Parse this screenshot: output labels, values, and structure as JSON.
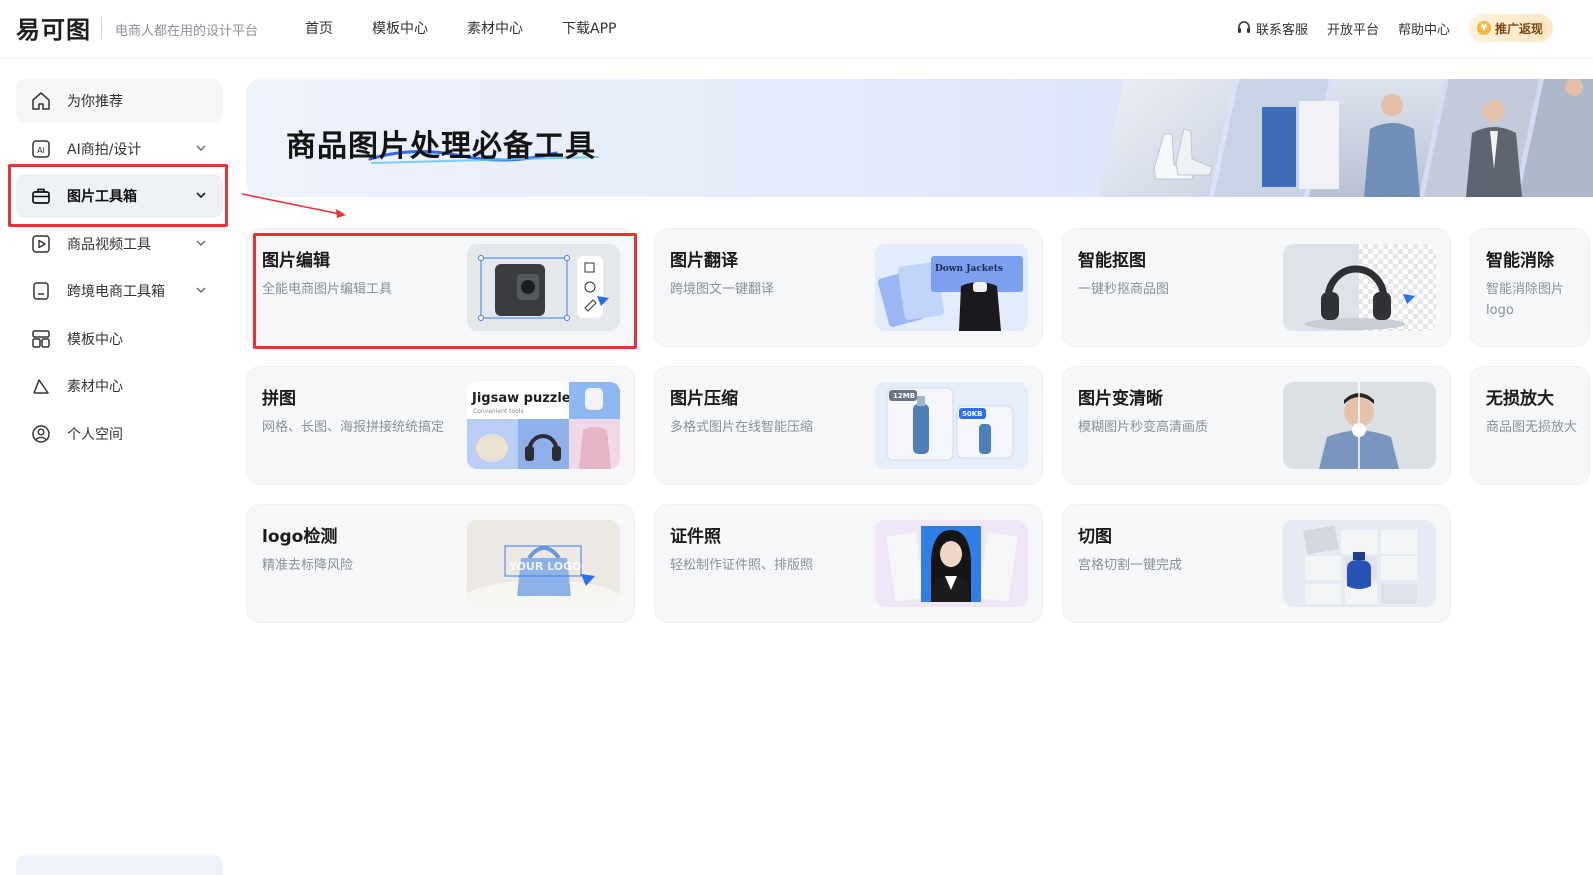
{
  "header": {
    "logo_text": "易可图",
    "slogan": "电商人都在用的设计平台",
    "nav": [
      "首页",
      "模板中心",
      "素材中心",
      "下载APP"
    ],
    "right_links": [
      "联系客服",
      "开放平台",
      "帮助中心"
    ],
    "promo": "推广返现"
  },
  "sidebar": {
    "items": [
      {
        "label": "为你推荐",
        "icon": "home-icon"
      },
      {
        "label": "AI商拍/设计",
        "icon": "ai-icon",
        "has_chevron": true
      },
      {
        "label": "图片工具箱",
        "icon": "toolbox-icon",
        "has_chevron": true,
        "active": true
      },
      {
        "label": "商品视频工具",
        "icon": "video-icon",
        "has_chevron": true
      },
      {
        "label": "跨境电商工具箱",
        "icon": "bookmark-icon",
        "has_chevron": true
      },
      {
        "label": "模板中心",
        "icon": "template-icon"
      },
      {
        "label": "素材中心",
        "icon": "shapes-icon"
      },
      {
        "label": "个人空间",
        "icon": "user-icon"
      }
    ]
  },
  "banner": {
    "title": "商品图片处理必备工具"
  },
  "tools": [
    {
      "title": "图片编辑",
      "desc": "全能电商图片编辑工具",
      "highlighted": true
    },
    {
      "title": "图片翻译",
      "desc": "跨境图文一键翻译",
      "thumb_text": "Down Jackets"
    },
    {
      "title": "智能抠图",
      "desc": "一键秒抠商品图"
    },
    {
      "title": "智能消除",
      "desc": "智能消除图片logo"
    },
    {
      "title": "拼图",
      "desc": "网格、长图、海报拼接统统搞定",
      "thumb_text": "Jigsaw puzzle",
      "thumb_sub": "Convenient tools"
    },
    {
      "title": "图片压缩",
      "desc": "多格式图片在线智能压缩",
      "thumb_badges": [
        "12MB",
        "50KB"
      ]
    },
    {
      "title": "图片变清晰",
      "desc": "模糊图片秒变高清画质"
    },
    {
      "title": "无损放大",
      "desc": "商品图无损放大"
    },
    {
      "title": "logo检测",
      "desc": "精准去标降风险",
      "thumb_text": "YOUR LOGO"
    },
    {
      "title": "证件照",
      "desc": "轻松制作证件照、排版照"
    },
    {
      "title": "切图",
      "desc": "宫格切割一键完成"
    }
  ],
  "colors": {
    "annotation_red": "#e53434",
    "accent_blue": "#2b6ef2",
    "card_bg": "#f6f7f9",
    "sidebar_active_bg": "#eef1f6"
  }
}
